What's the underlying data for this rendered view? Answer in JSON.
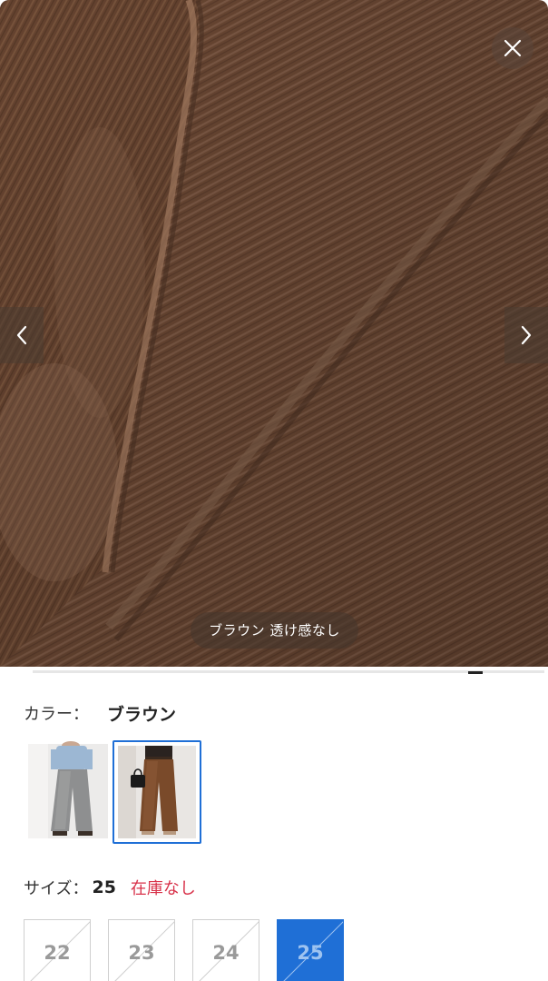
{
  "gallery": {
    "caption": "ブラウン 透け感なし",
    "image_desc_icon": "brown-twill-fabric-closeup",
    "close_icon": "close-icon",
    "prev_icon": "chevron-left-icon",
    "next_icon": "chevron-right-icon"
  },
  "color": {
    "label": "カラー：",
    "selected_value": "ブラウン",
    "swatches": [
      {
        "name": "gray-denim",
        "selected": false
      },
      {
        "name": "brown",
        "selected": true
      }
    ],
    "accent": "#1f6fd6"
  },
  "size": {
    "label": "サイズ：",
    "selected_value": "25",
    "stock_status": "在庫なし",
    "stock_color": "#d8324a",
    "options": [
      {
        "label": "22",
        "available": false,
        "selected": false
      },
      {
        "label": "23",
        "available": false,
        "selected": false
      },
      {
        "label": "24",
        "available": false,
        "selected": false
      },
      {
        "label": "25",
        "available": false,
        "selected": true
      }
    ]
  }
}
